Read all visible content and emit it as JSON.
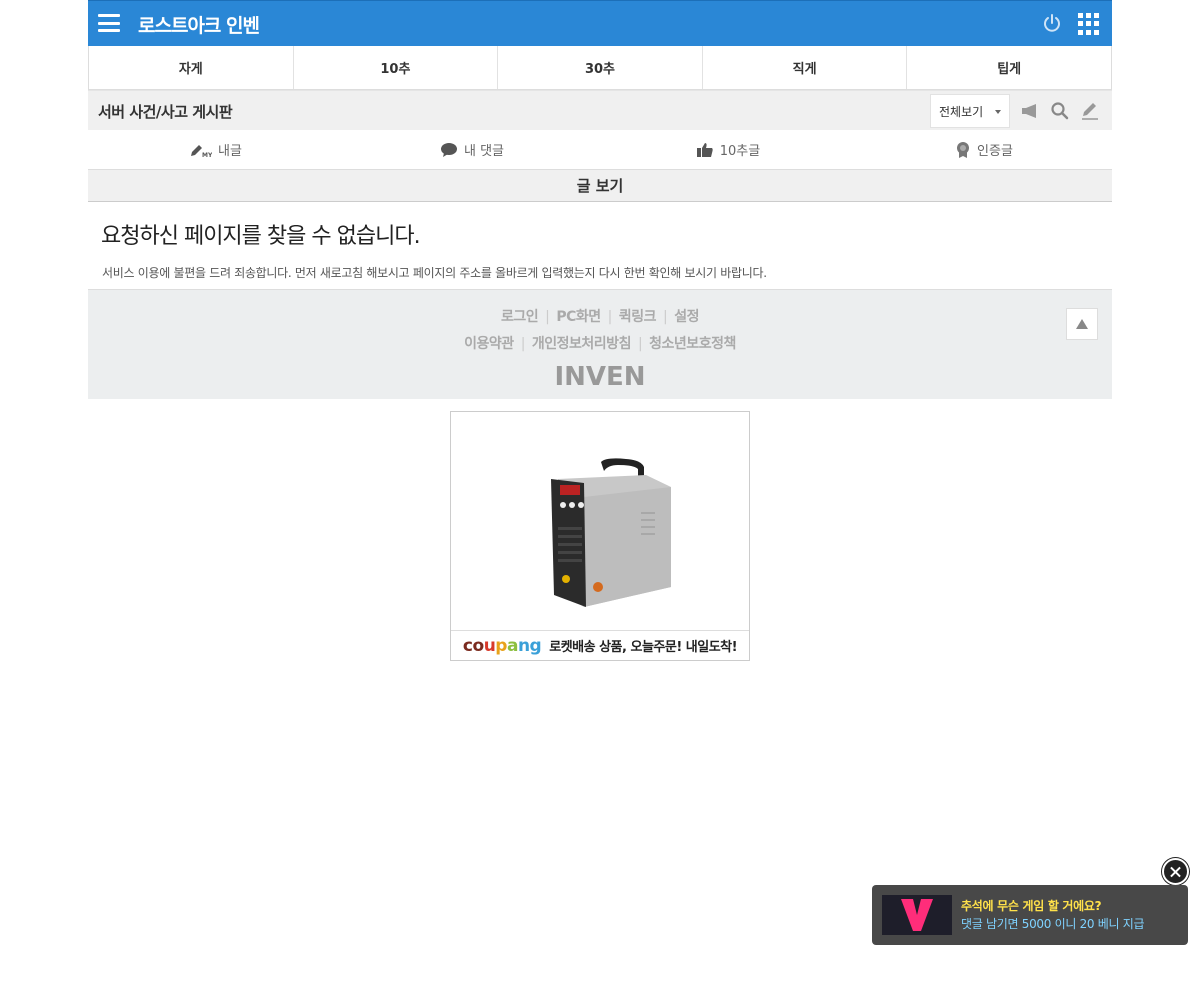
{
  "header": {
    "title": "로스트아크 인벤",
    "menu_icon": "hamburger-menu-icon",
    "power_icon": "power-icon",
    "apps_icon": "apps-grid-icon",
    "accent_color": "#2a87d6"
  },
  "tabs": [
    {
      "label": "자게"
    },
    {
      "label": "10추"
    },
    {
      "label": "30추"
    },
    {
      "label": "직게"
    },
    {
      "label": "팁게"
    }
  ],
  "board": {
    "title": "서버 사건/사고 게시판",
    "view_select": "전체보기",
    "icons": [
      "megaphone-icon",
      "search-icon",
      "pencil-icon"
    ]
  },
  "submenu": [
    {
      "label": "내글",
      "icon": "my-posts-icon"
    },
    {
      "label": "내 댓글",
      "icon": "speech-bubble-icon"
    },
    {
      "label": "10추글",
      "icon": "thumbs-up-icon"
    },
    {
      "label": "인증글",
      "icon": "badge-icon"
    }
  ],
  "section": {
    "title": "글 보기"
  },
  "error": {
    "title": "요청하신 페이지를 찾을 수 없습니다.",
    "description": "서비스 이용에 불편을 드려 죄송합니다. 먼저 새로고침 해보시고 페이지의 주소를 올바르게 입력했는지 다시 한번 확인해 보시기 바랍니다."
  },
  "footer": {
    "links_row1": [
      "로그인",
      "PC화면",
      "퀵링크",
      "설정"
    ],
    "links_row2": [
      "이용약관",
      "개인정보처리방침",
      "청소년보호정책"
    ],
    "logo": "INVEN"
  },
  "ad": {
    "brand": "coupang",
    "text": "로켓배송 상품, 오늘주문! 내일도착!"
  },
  "popup": {
    "line1": "추석에 무슨 게임 할 거에요?",
    "line2": "댓글 남기면 5000 이니 20 베니 지급"
  }
}
